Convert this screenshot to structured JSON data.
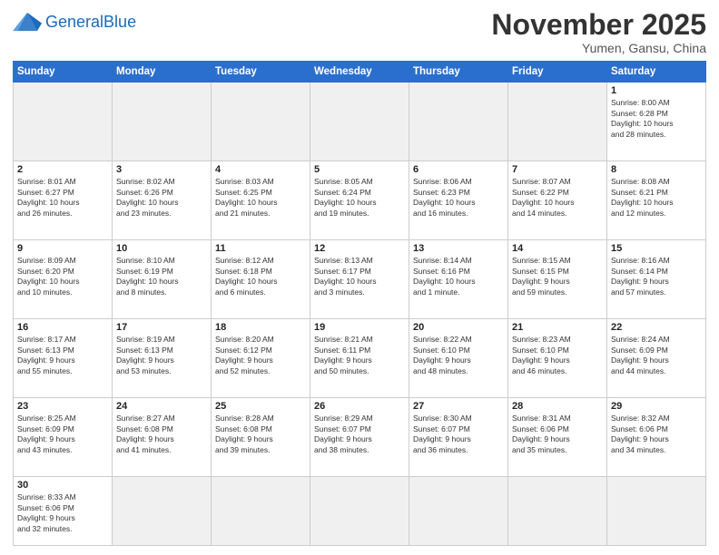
{
  "header": {
    "logo_general": "General",
    "logo_blue": "Blue",
    "month_title": "November 2025",
    "location": "Yumen, Gansu, China"
  },
  "weekdays": [
    "Sunday",
    "Monday",
    "Tuesday",
    "Wednesday",
    "Thursday",
    "Friday",
    "Saturday"
  ],
  "weeks": [
    [
      {
        "day": "",
        "info": "",
        "empty": true
      },
      {
        "day": "",
        "info": "",
        "empty": true
      },
      {
        "day": "",
        "info": "",
        "empty": true
      },
      {
        "day": "",
        "info": "",
        "empty": true
      },
      {
        "day": "",
        "info": "",
        "empty": true
      },
      {
        "day": "",
        "info": "",
        "empty": true
      },
      {
        "day": "1",
        "info": "Sunrise: 8:00 AM\nSunset: 6:28 PM\nDaylight: 10 hours\nand 28 minutes."
      }
    ],
    [
      {
        "day": "2",
        "info": "Sunrise: 8:01 AM\nSunset: 6:27 PM\nDaylight: 10 hours\nand 26 minutes."
      },
      {
        "day": "3",
        "info": "Sunrise: 8:02 AM\nSunset: 6:26 PM\nDaylight: 10 hours\nand 23 minutes."
      },
      {
        "day": "4",
        "info": "Sunrise: 8:03 AM\nSunset: 6:25 PM\nDaylight: 10 hours\nand 21 minutes."
      },
      {
        "day": "5",
        "info": "Sunrise: 8:05 AM\nSunset: 6:24 PM\nDaylight: 10 hours\nand 19 minutes."
      },
      {
        "day": "6",
        "info": "Sunrise: 8:06 AM\nSunset: 6:23 PM\nDaylight: 10 hours\nand 16 minutes."
      },
      {
        "day": "7",
        "info": "Sunrise: 8:07 AM\nSunset: 6:22 PM\nDaylight: 10 hours\nand 14 minutes."
      },
      {
        "day": "8",
        "info": "Sunrise: 8:08 AM\nSunset: 6:21 PM\nDaylight: 10 hours\nand 12 minutes."
      }
    ],
    [
      {
        "day": "9",
        "info": "Sunrise: 8:09 AM\nSunset: 6:20 PM\nDaylight: 10 hours\nand 10 minutes."
      },
      {
        "day": "10",
        "info": "Sunrise: 8:10 AM\nSunset: 6:19 PM\nDaylight: 10 hours\nand 8 minutes."
      },
      {
        "day": "11",
        "info": "Sunrise: 8:12 AM\nSunset: 6:18 PM\nDaylight: 10 hours\nand 6 minutes."
      },
      {
        "day": "12",
        "info": "Sunrise: 8:13 AM\nSunset: 6:17 PM\nDaylight: 10 hours\nand 3 minutes."
      },
      {
        "day": "13",
        "info": "Sunrise: 8:14 AM\nSunset: 6:16 PM\nDaylight: 10 hours\nand 1 minute."
      },
      {
        "day": "14",
        "info": "Sunrise: 8:15 AM\nSunset: 6:15 PM\nDaylight: 9 hours\nand 59 minutes."
      },
      {
        "day": "15",
        "info": "Sunrise: 8:16 AM\nSunset: 6:14 PM\nDaylight: 9 hours\nand 57 minutes."
      }
    ],
    [
      {
        "day": "16",
        "info": "Sunrise: 8:17 AM\nSunset: 6:13 PM\nDaylight: 9 hours\nand 55 minutes."
      },
      {
        "day": "17",
        "info": "Sunrise: 8:19 AM\nSunset: 6:13 PM\nDaylight: 9 hours\nand 53 minutes."
      },
      {
        "day": "18",
        "info": "Sunrise: 8:20 AM\nSunset: 6:12 PM\nDaylight: 9 hours\nand 52 minutes."
      },
      {
        "day": "19",
        "info": "Sunrise: 8:21 AM\nSunset: 6:11 PM\nDaylight: 9 hours\nand 50 minutes."
      },
      {
        "day": "20",
        "info": "Sunrise: 8:22 AM\nSunset: 6:10 PM\nDaylight: 9 hours\nand 48 minutes."
      },
      {
        "day": "21",
        "info": "Sunrise: 8:23 AM\nSunset: 6:10 PM\nDaylight: 9 hours\nand 46 minutes."
      },
      {
        "day": "22",
        "info": "Sunrise: 8:24 AM\nSunset: 6:09 PM\nDaylight: 9 hours\nand 44 minutes."
      }
    ],
    [
      {
        "day": "23",
        "info": "Sunrise: 8:25 AM\nSunset: 6:09 PM\nDaylight: 9 hours\nand 43 minutes."
      },
      {
        "day": "24",
        "info": "Sunrise: 8:27 AM\nSunset: 6:08 PM\nDaylight: 9 hours\nand 41 minutes."
      },
      {
        "day": "25",
        "info": "Sunrise: 8:28 AM\nSunset: 6:08 PM\nDaylight: 9 hours\nand 39 minutes."
      },
      {
        "day": "26",
        "info": "Sunrise: 8:29 AM\nSunset: 6:07 PM\nDaylight: 9 hours\nand 38 minutes."
      },
      {
        "day": "27",
        "info": "Sunrise: 8:30 AM\nSunset: 6:07 PM\nDaylight: 9 hours\nand 36 minutes."
      },
      {
        "day": "28",
        "info": "Sunrise: 8:31 AM\nSunset: 6:06 PM\nDaylight: 9 hours\nand 35 minutes."
      },
      {
        "day": "29",
        "info": "Sunrise: 8:32 AM\nSunset: 6:06 PM\nDaylight: 9 hours\nand 34 minutes."
      }
    ],
    [
      {
        "day": "30",
        "info": "Sunrise: 8:33 AM\nSunset: 6:06 PM\nDaylight: 9 hours\nand 32 minutes."
      },
      {
        "day": "",
        "info": "",
        "empty": true
      },
      {
        "day": "",
        "info": "",
        "empty": true
      },
      {
        "day": "",
        "info": "",
        "empty": true
      },
      {
        "day": "",
        "info": "",
        "empty": true
      },
      {
        "day": "",
        "info": "",
        "empty": true
      },
      {
        "day": "",
        "info": "",
        "empty": true
      }
    ]
  ]
}
